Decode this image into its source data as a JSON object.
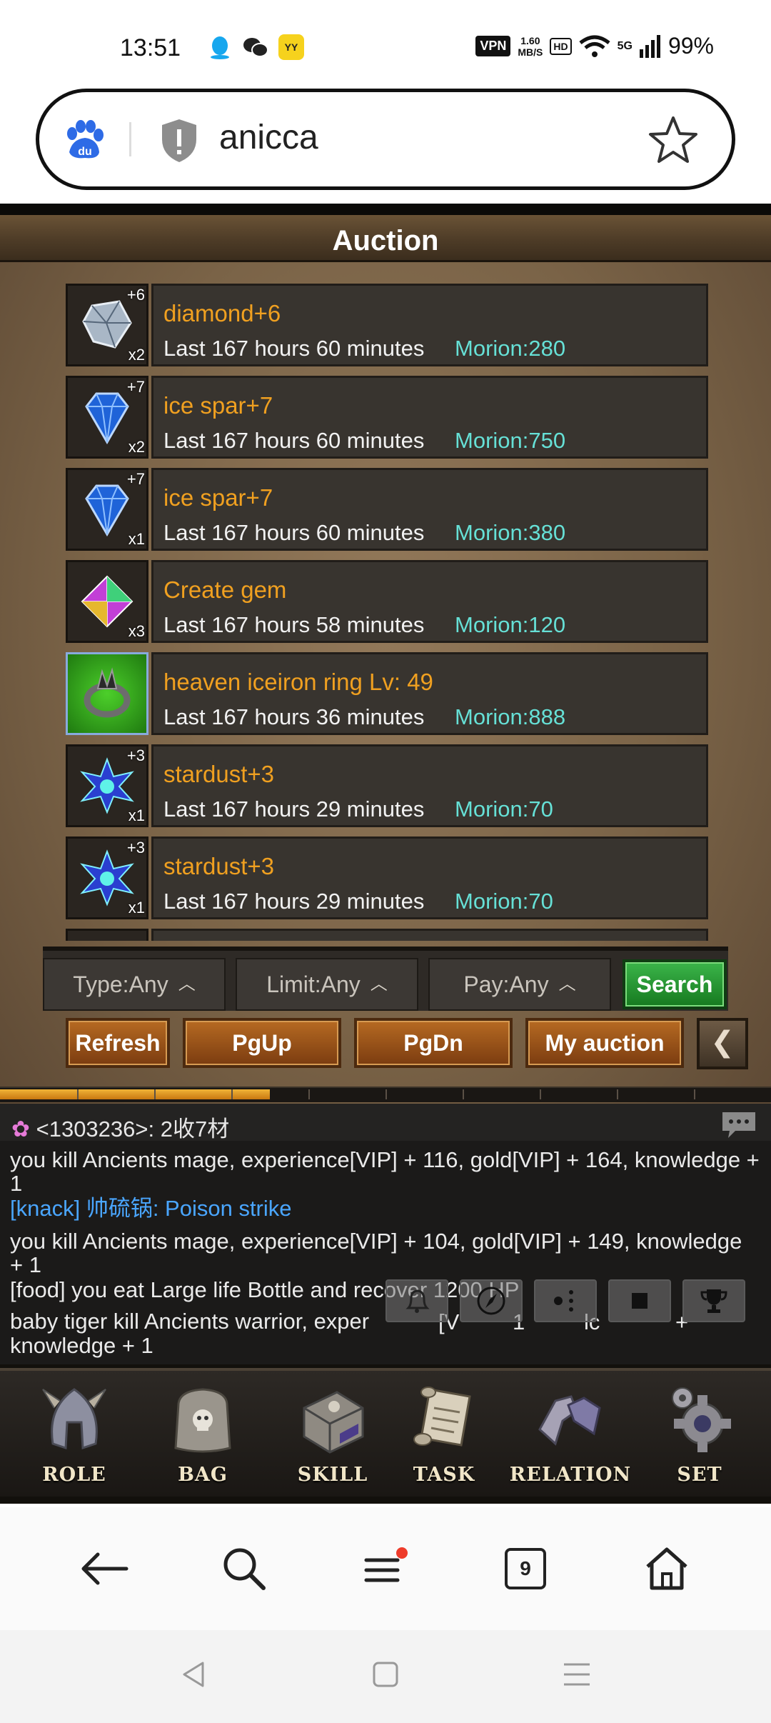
{
  "status_bar": {
    "time": "13:51",
    "app_icons": [
      "qq-icon",
      "wechat-icon",
      "yy-icon"
    ],
    "vpn": "VPN",
    "speed_value": "1.60",
    "speed_unit": "MB/S",
    "hd": "HD",
    "network": "5G",
    "battery": "99%"
  },
  "address_bar": {
    "url_text": "anicca"
  },
  "auction": {
    "title": "Auction",
    "items": [
      {
        "name": "diamond+6",
        "time": "Last 167 hours 60 minutes",
        "price": "Morion:280",
        "plus": "+6",
        "qty": "x2",
        "icon": "diamond-icon"
      },
      {
        "name": "ice spar+7",
        "time": "Last 167 hours 60 minutes",
        "price": "Morion:750",
        "plus": "+7",
        "qty": "x2",
        "icon": "ice-spar-icon"
      },
      {
        "name": "ice spar+7",
        "time": "Last 167 hours 60 minutes",
        "price": "Morion:380",
        "plus": "+7",
        "qty": "x1",
        "icon": "ice-spar-icon"
      },
      {
        "name": "Create gem",
        "time": "Last 167 hours 58 minutes",
        "price": "Morion:120",
        "plus": "",
        "qty": "x3",
        "icon": "create-gem-icon"
      },
      {
        "name": "heaven iceiron ring Lv: 49",
        "time": "Last 167 hours 36 minutes",
        "price": "Morion:888",
        "plus": "",
        "qty": "",
        "icon": "ring-icon"
      },
      {
        "name": "stardust+3",
        "time": "Last 167 hours 29 minutes",
        "price": "Morion:70",
        "plus": "+3",
        "qty": "x1",
        "icon": "stardust-icon"
      },
      {
        "name": "stardust+3",
        "time": "Last 167 hours 29 minutes",
        "price": "Morion:70",
        "plus": "+3",
        "qty": "x1",
        "icon": "stardust-icon"
      }
    ],
    "filters": {
      "type": "Type:Any",
      "limit": "Limit:Any",
      "pay": "Pay:Any",
      "search": "Search"
    },
    "buttons": {
      "refresh": "Refresh",
      "pgup": "PgUp",
      "pgdn": "PgDn",
      "my_auction": "My auction"
    },
    "xp_progress": 0.35
  },
  "chat": {
    "header": "<1303236>:  2收7材",
    "lines": [
      "you kill Ancients mage, experience[VIP] + 116, gold[VIP] + 164, knowledge + 1",
      "[knack] 帅硫锅: Poison strike",
      "you kill Ancients mage, experience[VIP] + 104, gold[VIP] + 149, knowledge + 1",
      "[food] you eat Large life Bottle and recover 1200 HP",
      "baby tiger kill Ancients warrior, exper",
      "knowledge + 1"
    ],
    "line5_fragments": [
      "[V",
      "1",
      "lc",
      "+"
    ]
  },
  "menu": {
    "role": "ROLE",
    "bag": "BAG",
    "skill": "SKILL",
    "task": "TASK",
    "relation": "RELATION",
    "set": "SET"
  },
  "browser_nav": {
    "tab_count": "9"
  },
  "colors": {
    "item_name": "#f0a020",
    "price": "#66e0d6",
    "search_green": "#16791f",
    "button_brown": "#9a5218"
  }
}
